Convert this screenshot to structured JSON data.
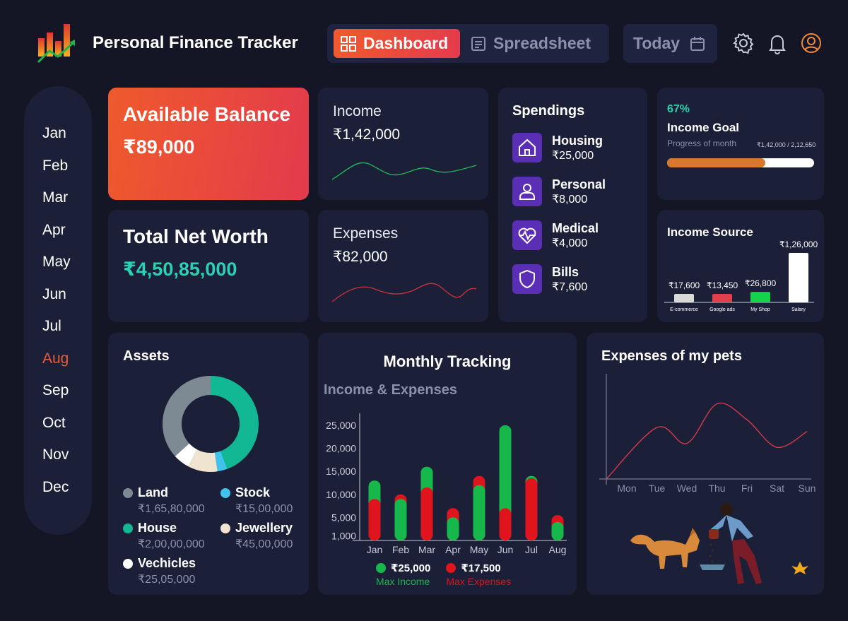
{
  "header": {
    "title": "Personal Finance Tracker",
    "tabs": [
      {
        "label": "Dashboard",
        "icon": "grid-icon",
        "active": true
      },
      {
        "label": "Spreadsheet",
        "icon": "document-icon",
        "active": false
      }
    ],
    "date_button": "Today",
    "icons": [
      "settings-icon",
      "bell-icon",
      "user-icon"
    ]
  },
  "months": [
    "Jan",
    "Feb",
    "Mar",
    "Apr",
    "May",
    "Jun",
    "Jul",
    "Aug",
    "Sep",
    "Oct",
    "Nov",
    "Dec"
  ],
  "active_month": "Aug",
  "balance": {
    "label": "Available Balance",
    "value": "₹89,000"
  },
  "net_worth": {
    "label": "Total Net Worth",
    "value": "₹4,50,85,000"
  },
  "income": {
    "label": "Income",
    "value": "₹1,42,000"
  },
  "expenses": {
    "label": "Expenses",
    "value": "₹82,000"
  },
  "spendings": {
    "title": "Spendings",
    "items": [
      {
        "name": "Housing",
        "value": "₹25,000",
        "icon": "house-icon"
      },
      {
        "name": "Personal",
        "value": "₹8,000",
        "icon": "person-icon"
      },
      {
        "name": "Medical",
        "value": "₹4,000",
        "icon": "heart-pulse-icon"
      },
      {
        "name": "Bills",
        "value": "₹7,600",
        "icon": "shield-icon"
      }
    ]
  },
  "income_goal": {
    "percent_label": "67%",
    "title": "Income Goal",
    "subtitle": "Progress of month",
    "progress_text": "₹1,42,000 / 2,12,650",
    "progress": 0.67
  },
  "income_source": {
    "title": "Income Source",
    "chart_data": {
      "type": "bar",
      "categories": [
        "E-commerce",
        "Google ads",
        "My Shop",
        "Salary"
      ],
      "values": [
        17600,
        13450,
        26800,
        126000
      ],
      "labels": [
        "₹17,600",
        "₹13,450",
        "₹26,800",
        "₹1,26,000"
      ],
      "colors": [
        "#d9d9d9",
        "#e0404e",
        "#16d34c",
        "#ffffff"
      ]
    }
  },
  "assets": {
    "title": "Assets",
    "chart_data": {
      "type": "pie",
      "categories": [
        "Land",
        "House",
        "Stock",
        "Jewellery",
        "Vechicles"
      ],
      "values": [
        16580000,
        20000000,
        1500000,
        4500000,
        2505000
      ],
      "colors": [
        "#7d8a93",
        "#12b893",
        "#3fc3ea",
        "#f0e4d0",
        "#ffffff"
      ]
    },
    "legend": [
      {
        "name": "Land",
        "value": "₹1,65,80,000",
        "color": "#7d8a93"
      },
      {
        "name": "Stock",
        "value": "₹15,00,000",
        "color": "#3fc3ea"
      },
      {
        "name": "House",
        "value": "₹2,00,00,000",
        "color": "#12b893"
      },
      {
        "name": "Jewellery",
        "value": "₹45,00,000",
        "color": "#f0e4d0"
      },
      {
        "name": "Vechicles",
        "value": "₹25,05,000",
        "color": "#ffffff"
      }
    ]
  },
  "monthly": {
    "title": "Monthly Tracking",
    "subtitle": "Income & Expenses",
    "chart_data": {
      "type": "bar",
      "categories": [
        "Jan",
        "Feb",
        "Mar",
        "Apr",
        "May",
        "Jun",
        "Jul",
        "Aug"
      ],
      "series": [
        {
          "name": "Income",
          "values": [
            13000,
            9000,
            16000,
            5000,
            12000,
            25000,
            14000,
            4000
          ],
          "color": "#16b84c"
        },
        {
          "name": "Expenses",
          "values": [
            9000,
            10000,
            11500,
            7000,
            14000,
            7000,
            13500,
            5500
          ],
          "color": "#e0141c"
        }
      ],
      "y_ticks": [
        "1,000",
        "5,000",
        "10,000",
        "15,000",
        "20,000",
        "25,000"
      ]
    },
    "legend": [
      {
        "value": "₹25,000",
        "label": "Max Income",
        "color": "#16b84c"
      },
      {
        "value": "₹17,500",
        "label": "Max Expenses",
        "color": "#e0141c"
      }
    ]
  },
  "pets": {
    "title": "Expenses of my pets",
    "chart_data": {
      "type": "line",
      "categories": [
        "Mon",
        "Tue",
        "Wed",
        "Thu",
        "Fri",
        "Sat",
        "Sun"
      ],
      "values": [
        0,
        65,
        45,
        95,
        75,
        40,
        60
      ],
      "color": "#d23a4a"
    }
  }
}
